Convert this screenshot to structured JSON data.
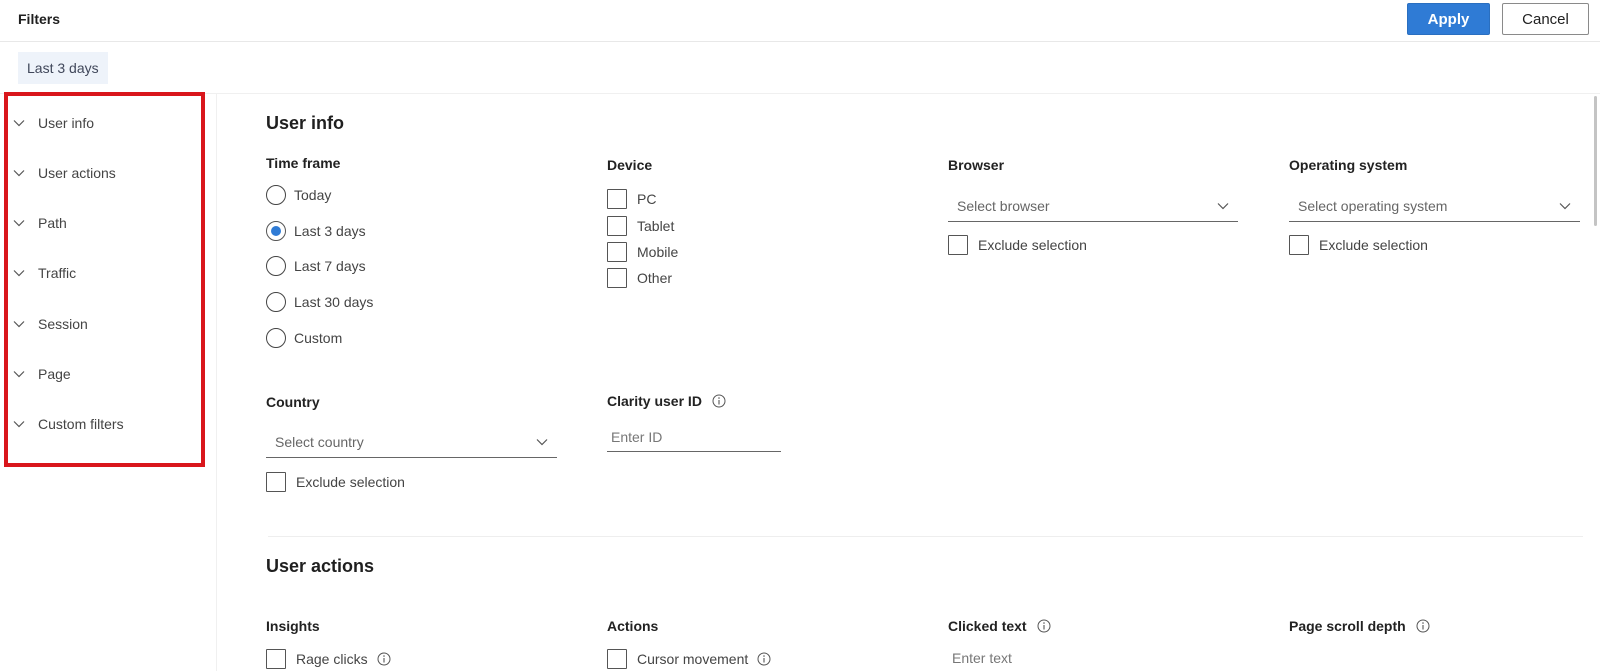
{
  "header": {
    "title": "Filters",
    "apply_label": "Apply",
    "cancel_label": "Cancel"
  },
  "chip": {
    "label": "Last 3 days"
  },
  "sidebar": {
    "items": [
      {
        "label": "User info"
      },
      {
        "label": "User actions"
      },
      {
        "label": "Path"
      },
      {
        "label": "Traffic"
      },
      {
        "label": "Session"
      },
      {
        "label": "Page"
      },
      {
        "label": "Custom filters"
      }
    ]
  },
  "user_info": {
    "heading": "User info",
    "time_frame": {
      "label": "Time frame",
      "options": [
        "Today",
        "Last 3 days",
        "Last 7 days",
        "Last 30 days",
        "Custom"
      ],
      "selected": "Last 3 days"
    },
    "device": {
      "label": "Device",
      "options": [
        "PC",
        "Tablet",
        "Mobile",
        "Other"
      ]
    },
    "browser": {
      "label": "Browser",
      "placeholder": "Select browser",
      "exclude_label": "Exclude selection"
    },
    "os": {
      "label": "Operating system",
      "placeholder": "Select operating system",
      "exclude_label": "Exclude selection"
    },
    "country": {
      "label": "Country",
      "placeholder": "Select country",
      "exclude_label": "Exclude selection"
    },
    "clarity_id": {
      "label": "Clarity user ID",
      "placeholder": "Enter ID"
    }
  },
  "user_actions": {
    "heading": "User actions",
    "insights": {
      "label": "Insights",
      "first_option": "Rage clicks"
    },
    "actions": {
      "label": "Actions",
      "first_option": "Cursor movement"
    },
    "clicked_text": {
      "label": "Clicked text",
      "placeholder": "Enter text"
    },
    "scroll_depth": {
      "label": "Page scroll depth"
    }
  },
  "colors": {
    "accent": "#2f7bd5",
    "highlight_border": "#d9161c",
    "chip_bg": "#eef3fa"
  }
}
